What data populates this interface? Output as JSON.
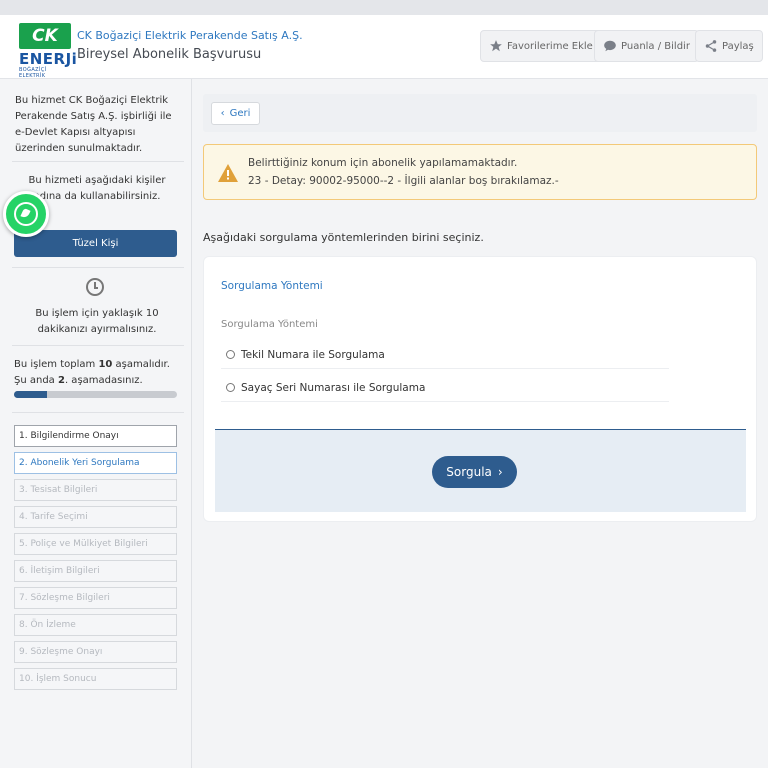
{
  "header": {
    "logo": {
      "mark": "CK",
      "word": "ENERJi",
      "sub": "BOĞAZİÇİ ELEKTRİK"
    },
    "company": "CK Boğaziçi Elektrik Perakende Satış A.Ş.",
    "service": "Bireysel Abonelik Başvurusu",
    "buttons": {
      "favorite": "Favorilerime Ekle",
      "rate": "Puanla / Bildir",
      "share": "Paylaş"
    }
  },
  "sidebar": {
    "intro": "Bu hizmet CK Boğaziçi Elektrik Perakende Satış A.Ş. işbirliği ile e-Devlet Kapısı altyapısı üzerinden sunulmaktadır.",
    "users_text": "Bu hizmeti aşağıdaki kişiler adına da kullanabilirsiniz.",
    "tuzel_button": "Tüzel Kişi",
    "time_text": "Bu işlem için yaklaşık 10 dakikanızı ayırmalısınız.",
    "progress": {
      "prefix": "Bu işlem toplam ",
      "total": "10",
      "middle": " aşamalıdır. Şu anda ",
      "current": "2",
      "suffix": ". aşamadasınız.",
      "fraction": 0.2
    },
    "steps": [
      {
        "label": "1. Bilgilendirme Onayı",
        "state": "done"
      },
      {
        "label": "2. Abonelik Yeri Sorgulama",
        "state": "active"
      },
      {
        "label": "3. Tesisat Bilgileri",
        "state": "pending"
      },
      {
        "label": "4. Tarife Seçimi",
        "state": "pending"
      },
      {
        "label": "5. Poliçe ve Mülkiyet Bilgileri",
        "state": "pending"
      },
      {
        "label": "6. İletişim Bilgileri",
        "state": "pending"
      },
      {
        "label": "7. Sözleşme Bilgileri",
        "state": "pending"
      },
      {
        "label": "8. Ön İzleme",
        "state": "pending"
      },
      {
        "label": "9. Sözleşme Onayı",
        "state": "pending"
      },
      {
        "label": "10. İşlem Sonucu",
        "state": "pending"
      }
    ]
  },
  "main": {
    "back_label": "Geri",
    "alert": {
      "line1": "Belirttiğiniz konum için abonelik yapılamamaktadır.",
      "line2": "23 - Detay: 90002-95000--2 - İlgili alanlar boş bırakılamaz.-"
    },
    "instruction": "Aşağıdaki sorgulama yöntemlerinden birini seçiniz.",
    "card": {
      "title": "Sorgulama Yöntemi",
      "field_label": "Sorgulama Yöntemi",
      "options": [
        "Tekil Numara ile Sorgulama",
        "Sayaç Seri Numarası ile Sorgulama"
      ],
      "submit_label": "Sorgula"
    }
  },
  "colors": {
    "primary": "#2e5c8e",
    "link": "#2e78c0",
    "warning_bg": "#fcf7e5",
    "warning_border": "#f3c978",
    "logo_green": "#1aa14d",
    "whatsapp": "#25d366"
  },
  "icons": {
    "favorite": "star-icon",
    "rate": "speech-bubble-icon",
    "share": "share-icon",
    "back": "chevron-left-icon",
    "alert": "warning-triangle-icon",
    "time": "clock-icon",
    "chat": "whatsapp-icon",
    "submit": "chevron-right-icon"
  }
}
